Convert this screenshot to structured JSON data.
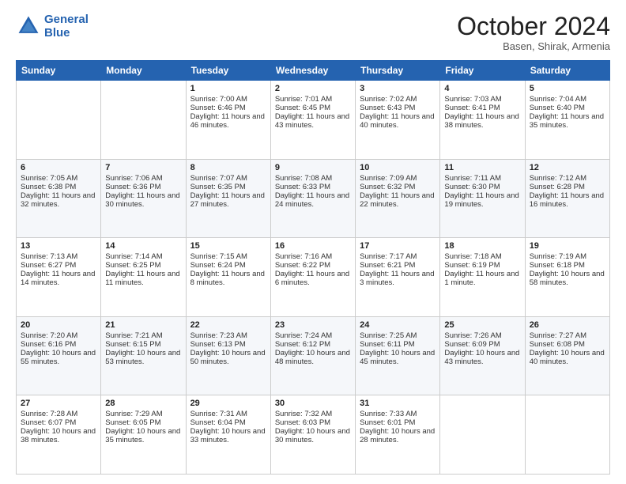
{
  "header": {
    "logo_line1": "General",
    "logo_line2": "Blue",
    "month": "October 2024",
    "location": "Basen, Shirak, Armenia"
  },
  "weekdays": [
    "Sunday",
    "Monday",
    "Tuesday",
    "Wednesday",
    "Thursday",
    "Friday",
    "Saturday"
  ],
  "weeks": [
    [
      {
        "day": "",
        "sunrise": "",
        "sunset": "",
        "daylight": ""
      },
      {
        "day": "",
        "sunrise": "",
        "sunset": "",
        "daylight": ""
      },
      {
        "day": "1",
        "sunrise": "Sunrise: 7:00 AM",
        "sunset": "Sunset: 6:46 PM",
        "daylight": "Daylight: 11 hours and 46 minutes."
      },
      {
        "day": "2",
        "sunrise": "Sunrise: 7:01 AM",
        "sunset": "Sunset: 6:45 PM",
        "daylight": "Daylight: 11 hours and 43 minutes."
      },
      {
        "day": "3",
        "sunrise": "Sunrise: 7:02 AM",
        "sunset": "Sunset: 6:43 PM",
        "daylight": "Daylight: 11 hours and 40 minutes."
      },
      {
        "day": "4",
        "sunrise": "Sunrise: 7:03 AM",
        "sunset": "Sunset: 6:41 PM",
        "daylight": "Daylight: 11 hours and 38 minutes."
      },
      {
        "day": "5",
        "sunrise": "Sunrise: 7:04 AM",
        "sunset": "Sunset: 6:40 PM",
        "daylight": "Daylight: 11 hours and 35 minutes."
      }
    ],
    [
      {
        "day": "6",
        "sunrise": "Sunrise: 7:05 AM",
        "sunset": "Sunset: 6:38 PM",
        "daylight": "Daylight: 11 hours and 32 minutes."
      },
      {
        "day": "7",
        "sunrise": "Sunrise: 7:06 AM",
        "sunset": "Sunset: 6:36 PM",
        "daylight": "Daylight: 11 hours and 30 minutes."
      },
      {
        "day": "8",
        "sunrise": "Sunrise: 7:07 AM",
        "sunset": "Sunset: 6:35 PM",
        "daylight": "Daylight: 11 hours and 27 minutes."
      },
      {
        "day": "9",
        "sunrise": "Sunrise: 7:08 AM",
        "sunset": "Sunset: 6:33 PM",
        "daylight": "Daylight: 11 hours and 24 minutes."
      },
      {
        "day": "10",
        "sunrise": "Sunrise: 7:09 AM",
        "sunset": "Sunset: 6:32 PM",
        "daylight": "Daylight: 11 hours and 22 minutes."
      },
      {
        "day": "11",
        "sunrise": "Sunrise: 7:11 AM",
        "sunset": "Sunset: 6:30 PM",
        "daylight": "Daylight: 11 hours and 19 minutes."
      },
      {
        "day": "12",
        "sunrise": "Sunrise: 7:12 AM",
        "sunset": "Sunset: 6:28 PM",
        "daylight": "Daylight: 11 hours and 16 minutes."
      }
    ],
    [
      {
        "day": "13",
        "sunrise": "Sunrise: 7:13 AM",
        "sunset": "Sunset: 6:27 PM",
        "daylight": "Daylight: 11 hours and 14 minutes."
      },
      {
        "day": "14",
        "sunrise": "Sunrise: 7:14 AM",
        "sunset": "Sunset: 6:25 PM",
        "daylight": "Daylight: 11 hours and 11 minutes."
      },
      {
        "day": "15",
        "sunrise": "Sunrise: 7:15 AM",
        "sunset": "Sunset: 6:24 PM",
        "daylight": "Daylight: 11 hours and 8 minutes."
      },
      {
        "day": "16",
        "sunrise": "Sunrise: 7:16 AM",
        "sunset": "Sunset: 6:22 PM",
        "daylight": "Daylight: 11 hours and 6 minutes."
      },
      {
        "day": "17",
        "sunrise": "Sunrise: 7:17 AM",
        "sunset": "Sunset: 6:21 PM",
        "daylight": "Daylight: 11 hours and 3 minutes."
      },
      {
        "day": "18",
        "sunrise": "Sunrise: 7:18 AM",
        "sunset": "Sunset: 6:19 PM",
        "daylight": "Daylight: 11 hours and 1 minute."
      },
      {
        "day": "19",
        "sunrise": "Sunrise: 7:19 AM",
        "sunset": "Sunset: 6:18 PM",
        "daylight": "Daylight: 10 hours and 58 minutes."
      }
    ],
    [
      {
        "day": "20",
        "sunrise": "Sunrise: 7:20 AM",
        "sunset": "Sunset: 6:16 PM",
        "daylight": "Daylight: 10 hours and 55 minutes."
      },
      {
        "day": "21",
        "sunrise": "Sunrise: 7:21 AM",
        "sunset": "Sunset: 6:15 PM",
        "daylight": "Daylight: 10 hours and 53 minutes."
      },
      {
        "day": "22",
        "sunrise": "Sunrise: 7:23 AM",
        "sunset": "Sunset: 6:13 PM",
        "daylight": "Daylight: 10 hours and 50 minutes."
      },
      {
        "day": "23",
        "sunrise": "Sunrise: 7:24 AM",
        "sunset": "Sunset: 6:12 PM",
        "daylight": "Daylight: 10 hours and 48 minutes."
      },
      {
        "day": "24",
        "sunrise": "Sunrise: 7:25 AM",
        "sunset": "Sunset: 6:11 PM",
        "daylight": "Daylight: 10 hours and 45 minutes."
      },
      {
        "day": "25",
        "sunrise": "Sunrise: 7:26 AM",
        "sunset": "Sunset: 6:09 PM",
        "daylight": "Daylight: 10 hours and 43 minutes."
      },
      {
        "day": "26",
        "sunrise": "Sunrise: 7:27 AM",
        "sunset": "Sunset: 6:08 PM",
        "daylight": "Daylight: 10 hours and 40 minutes."
      }
    ],
    [
      {
        "day": "27",
        "sunrise": "Sunrise: 7:28 AM",
        "sunset": "Sunset: 6:07 PM",
        "daylight": "Daylight: 10 hours and 38 minutes."
      },
      {
        "day": "28",
        "sunrise": "Sunrise: 7:29 AM",
        "sunset": "Sunset: 6:05 PM",
        "daylight": "Daylight: 10 hours and 35 minutes."
      },
      {
        "day": "29",
        "sunrise": "Sunrise: 7:31 AM",
        "sunset": "Sunset: 6:04 PM",
        "daylight": "Daylight: 10 hours and 33 minutes."
      },
      {
        "day": "30",
        "sunrise": "Sunrise: 7:32 AM",
        "sunset": "Sunset: 6:03 PM",
        "daylight": "Daylight: 10 hours and 30 minutes."
      },
      {
        "day": "31",
        "sunrise": "Sunrise: 7:33 AM",
        "sunset": "Sunset: 6:01 PM",
        "daylight": "Daylight: 10 hours and 28 minutes."
      },
      {
        "day": "",
        "sunrise": "",
        "sunset": "",
        "daylight": ""
      },
      {
        "day": "",
        "sunrise": "",
        "sunset": "",
        "daylight": ""
      }
    ]
  ]
}
